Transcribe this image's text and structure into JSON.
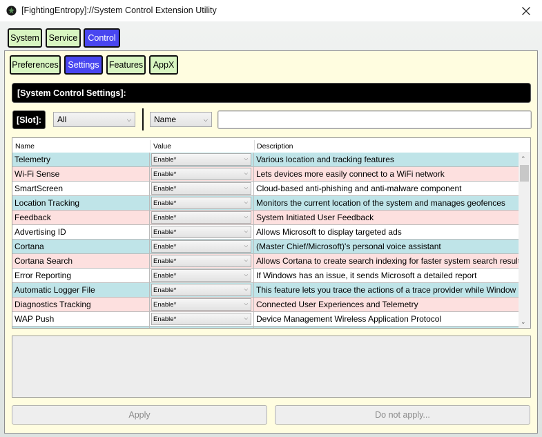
{
  "window": {
    "title": "[FightingEntropy]://System Control Extension Utility"
  },
  "main_tabs": [
    {
      "label": "System",
      "active": false
    },
    {
      "label": "Service",
      "active": false
    },
    {
      "label": "Control",
      "active": true
    }
  ],
  "sub_tabs": [
    {
      "label": "Preferences",
      "active": false
    },
    {
      "label": "Settings",
      "active": true
    },
    {
      "label": "Features",
      "active": false
    },
    {
      "label": "AppX",
      "active": false
    }
  ],
  "section_title": "[System Control Settings]:",
  "filter": {
    "slot_label": "[Slot]:",
    "slot_value": "All",
    "property_value": "Name",
    "search_value": ""
  },
  "grid": {
    "headers": {
      "name": "Name",
      "value": "Value",
      "description": "Description"
    },
    "rows": [
      {
        "name": "Telemetry",
        "value": "Enable*",
        "description": "Various location and tracking features",
        "color": "#bfe4e8"
      },
      {
        "name": "Wi-Fi Sense",
        "value": "Enable*",
        "description": "Lets devices more easily connect to a WiFi network",
        "color": "#fde0df"
      },
      {
        "name": "SmartScreen",
        "value": "Enable*",
        "description": "Cloud-based anti-phishing and anti-malware component",
        "color": "#ffffff"
      },
      {
        "name": "Location Tracking",
        "value": "Enable*",
        "description": "Monitors the current location of the system and manages geofences",
        "color": "#bfe4e8"
      },
      {
        "name": "Feedback",
        "value": "Enable*",
        "description": "System Initiated User Feedback",
        "color": "#fde0df"
      },
      {
        "name": "Advertising ID",
        "value": "Enable*",
        "description": "Allows Microsoft to display targeted ads",
        "color": "#ffffff"
      },
      {
        "name": "Cortana",
        "value": "Enable*",
        "description": "(Master Chief/Microsoft)'s personal voice assistant",
        "color": "#bfe4e8"
      },
      {
        "name": "Cortana Search",
        "value": "Enable*",
        "description": "Allows Cortana to create search indexing for faster system search result",
        "color": "#fde0df"
      },
      {
        "name": "Error Reporting",
        "value": "Enable*",
        "description": "If Windows has an issue, it sends Microsoft a detailed report",
        "color": "#ffffff"
      },
      {
        "name": "Automatic Logger File",
        "value": "Enable*",
        "description": "This feature lets you trace the actions of a trace provider while Window",
        "color": "#bfe4e8"
      },
      {
        "name": "Diagnostics Tracking",
        "value": "Enable*",
        "description": "Connected User Experiences and Telemetry",
        "color": "#fde0df"
      },
      {
        "name": "WAP Push",
        "value": "Enable*",
        "description": "Device Management Wireless Application Protocol",
        "color": "#ffffff"
      },
      {
        "name": "",
        "value": "",
        "description": "",
        "color": "#bfe4e8"
      }
    ]
  },
  "buttons": {
    "apply": "Apply",
    "do_not_apply": "Do not apply..."
  },
  "colors": {
    "tab_active": "#4846f0",
    "tab_inactive": "#d8f5c1",
    "panel": "#fffde0"
  },
  "icons": {
    "app": "app-icon",
    "close": "close-icon",
    "dropdown": "chevron-down-icon"
  }
}
